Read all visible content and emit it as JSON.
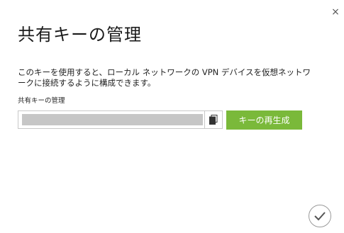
{
  "dialog": {
    "close_glyph": "×",
    "title": "共有キーの管理",
    "description": "このキーを使用すると、ローカル ネットワークの VPN デバイスを仮想ネットワークに接続するように構成できます。",
    "field_label": "共有キーの管理",
    "key_value_masked": true,
    "copy_icon": "copy-icon",
    "regenerate_label": "キーの再生成",
    "confirm_icon": "checkmark-icon"
  },
  "colors": {
    "accent_green": "#7ab93a",
    "masked_bar": "#c6c6c6",
    "border": "#c8c8c8"
  }
}
